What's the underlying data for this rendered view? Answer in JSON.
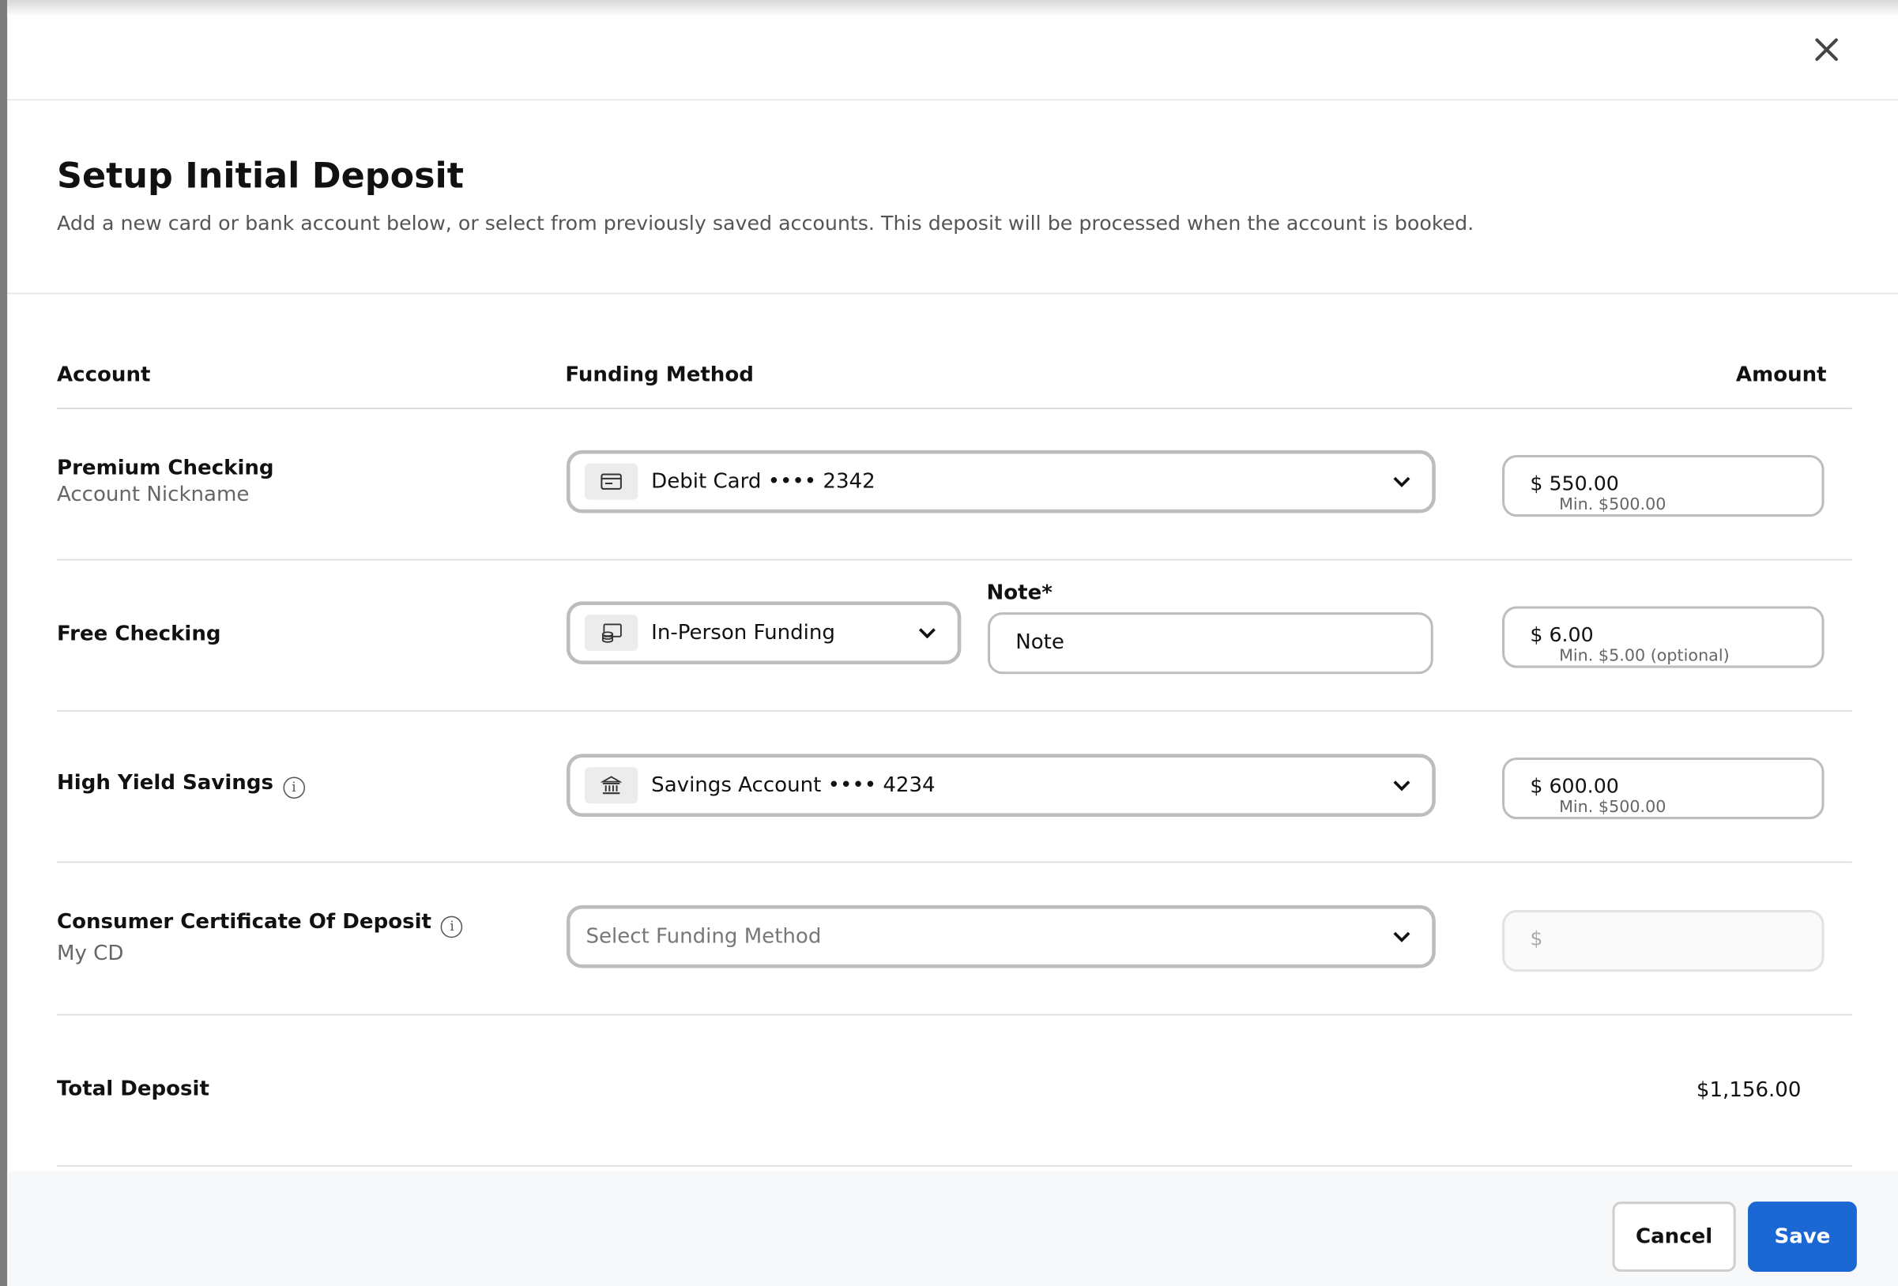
{
  "dialog": {
    "title": "Setup Initial Deposit",
    "subtitle": "Add a new card or bank account below, or select from previously saved accounts. This deposit will be processed when the account is booked."
  },
  "columns": {
    "account": "Account",
    "funding": "Funding Method",
    "amount": "Amount"
  },
  "rows": [
    {
      "name": "Premium Checking",
      "nickname": "Account Nickname",
      "funding": "Debit Card •••• 2342",
      "funding_icon": "credit-card-icon",
      "amount": "$ 550.00",
      "min": "Min. $500.00"
    },
    {
      "name": "Free Checking",
      "funding": "In-Person Funding",
      "funding_icon": "cash-coins-icon",
      "note_label": "Note*",
      "note_value": "Note",
      "amount": "$ 6.00",
      "min": "Min. $5.00 (optional)"
    },
    {
      "name": "High Yield Savings",
      "funding": "Savings Account •••• 4234",
      "funding_icon": "bank-icon",
      "amount": "$ 600.00",
      "min": "Min. $500.00"
    },
    {
      "name": "Consumer Certificate Of Deposit",
      "nickname": "My CD",
      "funding_placeholder": "Select Funding Method",
      "amount_placeholder": "$"
    }
  ],
  "total": {
    "label": "Total Deposit",
    "value": "$1,156.00"
  },
  "buttons": {
    "cancel": "Cancel",
    "save": "Save"
  },
  "colors": {
    "primary": "#1b67d3",
    "footer_bg": "#f7f8fa",
    "border": "#bdbdbd"
  }
}
